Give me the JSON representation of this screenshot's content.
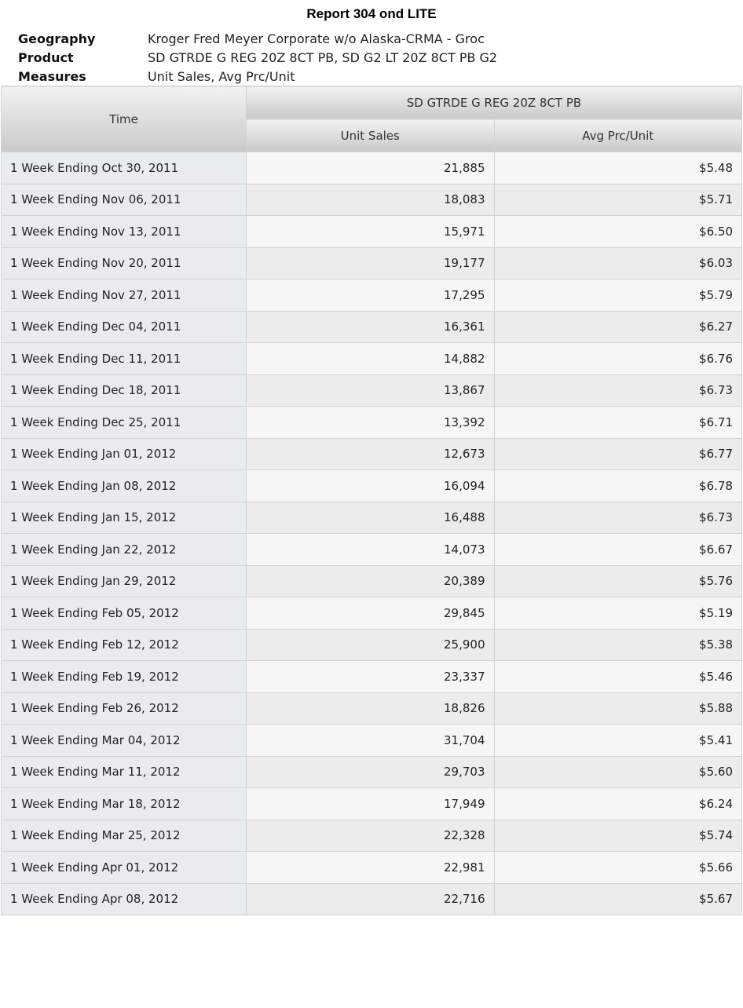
{
  "report": {
    "title": "Report 304 ond LITE",
    "meta": [
      {
        "label": "Geography",
        "value": "Kroger Fred Meyer Corporate w/o Alaska-CRMA - Groc"
      },
      {
        "label": "Product",
        "value": "SD GTRDE G REG 20Z 8CT PB, SD G2 LT 20Z 8CT PB G2"
      },
      {
        "label": "Measures",
        "value": "Unit Sales, Avg Prc/Unit"
      }
    ]
  },
  "table": {
    "time_header": "Time",
    "product_header": "SD GTRDE G REG 20Z 8CT PB",
    "columns": [
      "Unit Sales",
      "Avg Prc/Unit"
    ],
    "rows": [
      {
        "time": "1 Week Ending Oct 30, 2011",
        "units": "21,885",
        "price": "$5.48"
      },
      {
        "time": "1 Week Ending Nov 06, 2011",
        "units": "18,083",
        "price": "$5.71"
      },
      {
        "time": "1 Week Ending Nov 13, 2011",
        "units": "15,971",
        "price": "$6.50"
      },
      {
        "time": "1 Week Ending Nov 20, 2011",
        "units": "19,177",
        "price": "$6.03"
      },
      {
        "time": "1 Week Ending Nov 27, 2011",
        "units": "17,295",
        "price": "$5.79"
      },
      {
        "time": "1 Week Ending Dec 04, 2011",
        "units": "16,361",
        "price": "$6.27"
      },
      {
        "time": "1 Week Ending Dec 11, 2011",
        "units": "14,882",
        "price": "$6.76"
      },
      {
        "time": "1 Week Ending Dec 18, 2011",
        "units": "13,867",
        "price": "$6.73"
      },
      {
        "time": "1 Week Ending Dec 25, 2011",
        "units": "13,392",
        "price": "$6.71"
      },
      {
        "time": "1 Week Ending Jan 01, 2012",
        "units": "12,673",
        "price": "$6.77"
      },
      {
        "time": "1 Week Ending Jan 08, 2012",
        "units": "16,094",
        "price": "$6.78"
      },
      {
        "time": "1 Week Ending Jan 15, 2012",
        "units": "16,488",
        "price": "$6.73"
      },
      {
        "time": "1 Week Ending Jan 22, 2012",
        "units": "14,073",
        "price": "$6.67"
      },
      {
        "time": "1 Week Ending Jan 29, 2012",
        "units": "20,389",
        "price": "$5.76"
      },
      {
        "time": "1 Week Ending Feb 05, 2012",
        "units": "29,845",
        "price": "$5.19"
      },
      {
        "time": "1 Week Ending Feb 12, 2012",
        "units": "25,900",
        "price": "$5.38"
      },
      {
        "time": "1 Week Ending Feb 19, 2012",
        "units": "23,337",
        "price": "$5.46"
      },
      {
        "time": "1 Week Ending Feb 26, 2012",
        "units": "18,826",
        "price": "$5.88"
      },
      {
        "time": "1 Week Ending Mar 04, 2012",
        "units": "31,704",
        "price": "$5.41"
      },
      {
        "time": "1 Week Ending Mar 11, 2012",
        "units": "29,703",
        "price": "$5.60"
      },
      {
        "time": "1 Week Ending Mar 18, 2012",
        "units": "17,949",
        "price": "$6.24"
      },
      {
        "time": "1 Week Ending Mar 25, 2012",
        "units": "22,328",
        "price": "$5.74"
      },
      {
        "time": "1 Week Ending Apr 01, 2012",
        "units": "22,981",
        "price": "$5.66"
      },
      {
        "time": "1 Week Ending Apr 08, 2012",
        "units": "22,716",
        "price": "$5.67"
      }
    ]
  }
}
